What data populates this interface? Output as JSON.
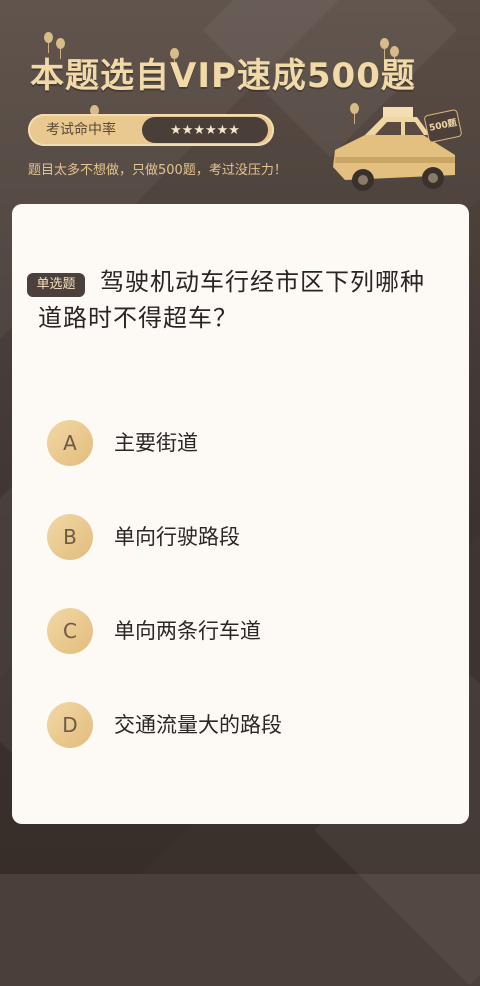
{
  "banner": {
    "title": "本题选自VIP速成500题",
    "rate_label": "考试命中率",
    "rate_stars": "★★★★★★",
    "slogan": "题目太多不想做，只做500题，考过没压力！",
    "car_badge": "500题"
  },
  "question": {
    "type_tag": "单选题",
    "text": "驾驶机动车行经市区下列哪种道路时不得超车？",
    "options": [
      {
        "letter": "A",
        "text": "主要街道"
      },
      {
        "letter": "B",
        "text": "单向行驶路段"
      },
      {
        "letter": "C",
        "text": "单向两条行车道"
      },
      {
        "letter": "D",
        "text": "交通流量大的路段"
      }
    ]
  },
  "colors": {
    "background": "#4a3f3a",
    "gold": "#e9c98f",
    "card": "#fdfaf6",
    "text": "#2a2422"
  }
}
